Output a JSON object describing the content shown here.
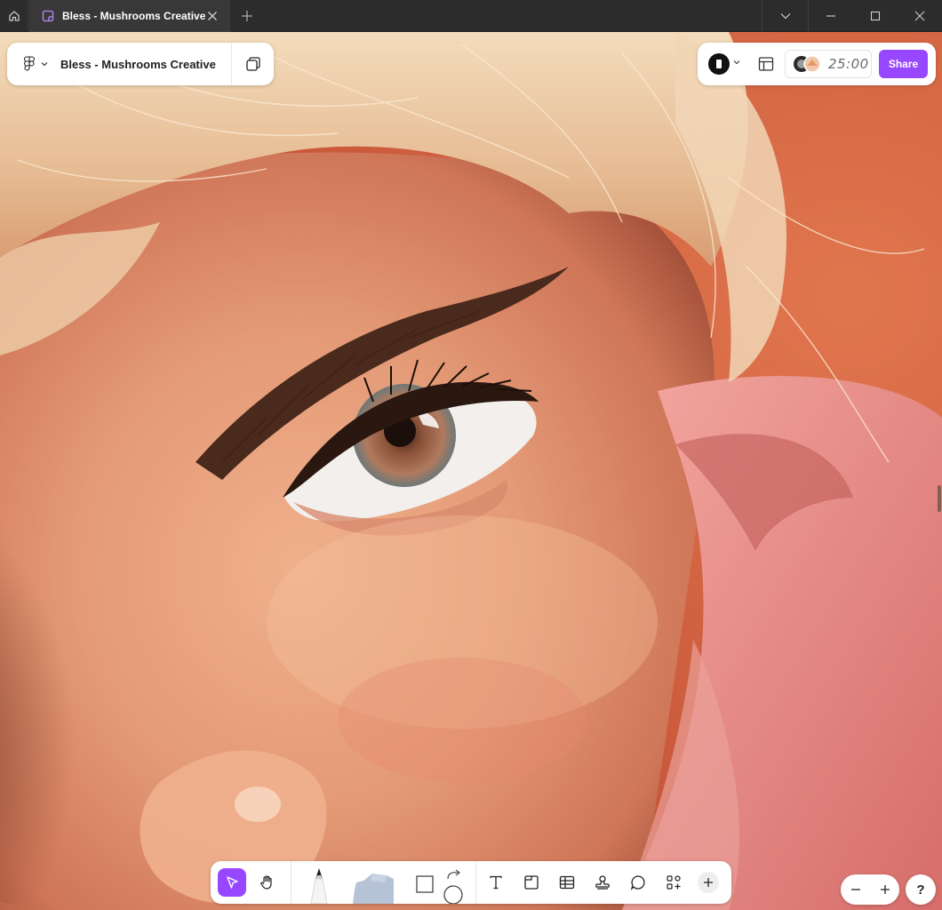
{
  "window": {
    "tab_title": "Bless - Mushrooms Creative",
    "home_icon": "home-icon",
    "new_tab_icon": "plus-icon",
    "controls": [
      "chevron-down-icon",
      "minimize-icon",
      "maximize-icon",
      "close-icon"
    ]
  },
  "file": {
    "name": "Bless - Mushrooms Creative",
    "menu_icon": "figma-logo-icon",
    "pages_icon": "pages-icon"
  },
  "header_right": {
    "timer": "25:00",
    "share_label": "Share",
    "share_color": "#9747ff"
  },
  "toolbar": {
    "tools": [
      "move",
      "hand",
      "marker",
      "highlighter",
      "shape",
      "connector",
      "text",
      "section",
      "table",
      "stamp",
      "comment",
      "widgets",
      "more"
    ],
    "active_tool": "move",
    "accent": "#9747ff"
  },
  "zoom": {
    "out_label": "−",
    "in_label": "+",
    "help_label": "?"
  }
}
